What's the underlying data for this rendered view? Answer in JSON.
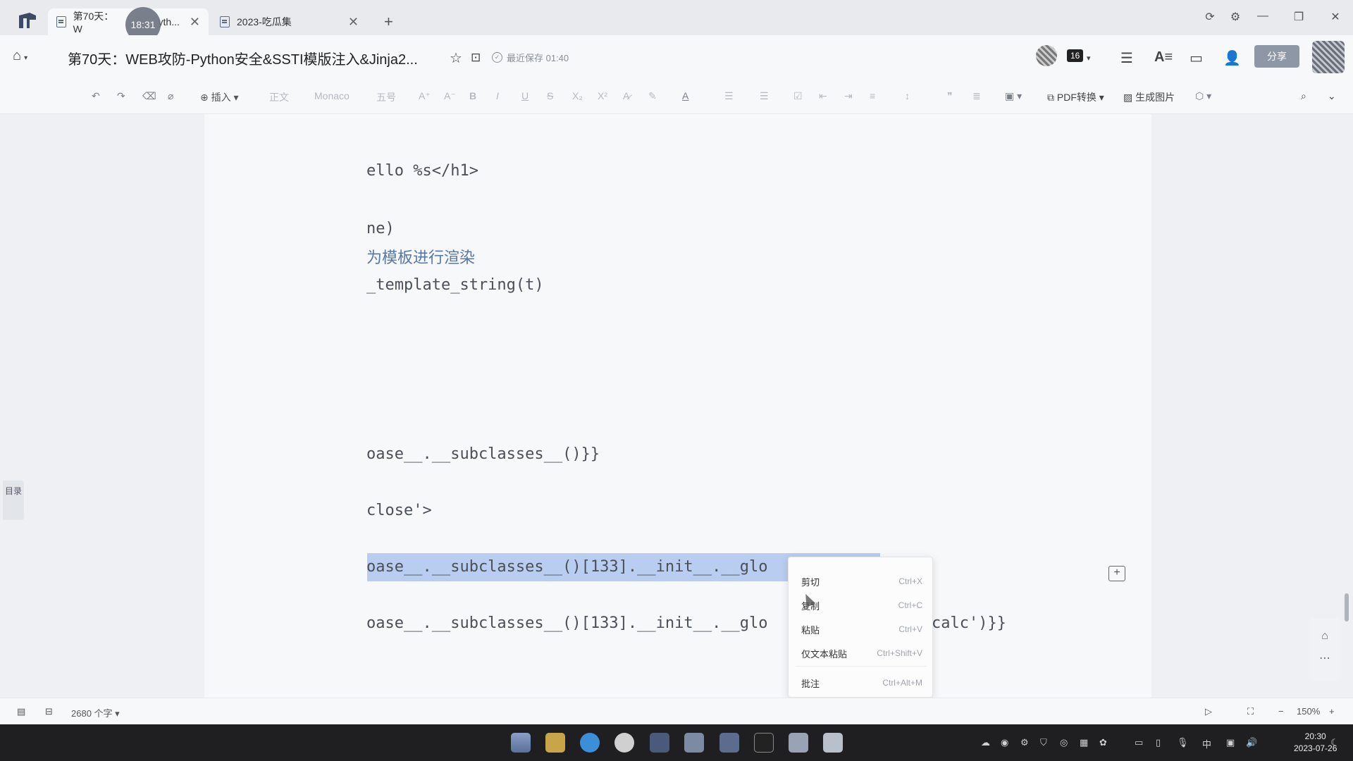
{
  "tabs": [
    {
      "label": "第70天：W",
      "label_tail": "yth...",
      "active": true
    },
    {
      "label": "2023-吃瓜集",
      "active": false
    }
  ],
  "timer_badge": "18:31",
  "document": {
    "title": "第70天：WEB攻防-Python安全&SSTI模版注入&Jinja2...",
    "save_status": "最近保存 01:40",
    "collab_count": "16",
    "share_label": "分享"
  },
  "toolbar": {
    "insert_label": "插入",
    "style_label": "正文",
    "font_label": "Monaco",
    "size_label": "五号",
    "pdf_label": "PDF转换",
    "image_label": "生成图片"
  },
  "toc_label": "目录",
  "code_lines": [
    "ello %s</h1>",
    "ne)",
    "为模板进行渲染",
    "_template_string(t)",
    "oase__.__subclasses__()}}",
    "close'>",
    "oase__.__subclasses__()[133].__init__.__glo",
    "oase__.__subclasses__()[133].__init__.__glo",
    "calc')}}"
  ],
  "context_menu": [
    {
      "label": "剪切",
      "shortcut": "Ctrl+X"
    },
    {
      "label": "复制",
      "shortcut": "Ctrl+C"
    },
    {
      "label": "粘贴",
      "shortcut": "Ctrl+V"
    },
    {
      "label": "仅文本粘贴",
      "shortcut": "Ctrl+Shift+V"
    },
    {
      "label": "批注",
      "shortcut": "Ctrl+Alt+M"
    }
  ],
  "statusbar": {
    "word_count": "2680 个字",
    "zoom": "150%"
  },
  "taskbar": {
    "ime": "中",
    "time": "20:30",
    "date": "2023-07-26"
  }
}
